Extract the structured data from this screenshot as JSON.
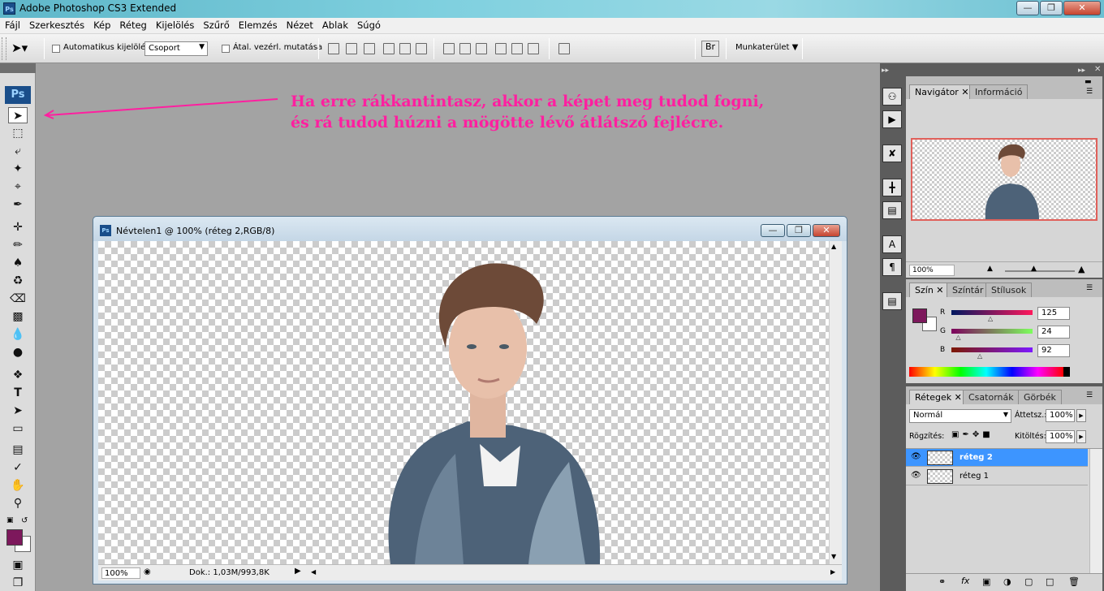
{
  "window": {
    "title": "Adobe Photoshop CS3 Extended",
    "ps_badge": "Ps"
  },
  "menu": [
    "Fájl",
    "Szerkesztés",
    "Kép",
    "Réteg",
    "Kijelölés",
    "Szűrő",
    "Elemzés",
    "Nézet",
    "Ablak",
    "Súgó"
  ],
  "options": {
    "auto_select_label": "Automatikus kijelölés:",
    "auto_select_value": "Csoport",
    "show_transform_label": "Átal. vezérl. mutatása",
    "workspace_label": "Munkaterület"
  },
  "instruction": {
    "line1": "Ha erre rákkantintasz, akkor a képet meg tudod fogni,",
    "line2": "és rá tudod húzni a mögötte lévő átlátszó fejlécre.",
    "color": "#ff1fa0"
  },
  "document": {
    "title": "Névtelen1 @ 100% (réteg 2,RGB/8)",
    "zoom": "100%",
    "doc_size": "Dok.: 1,03M/993,8K"
  },
  "navigator": {
    "tabs": [
      "Navigátor",
      "Információ"
    ],
    "zoom": "100%"
  },
  "color_panel": {
    "tabs": [
      "Szín",
      "Színtár",
      "Stílusok"
    ],
    "foreground": "#7d185c",
    "channels": [
      {
        "label": "R",
        "value": "125",
        "level": 0.49
      },
      {
        "label": "G",
        "value": "24",
        "level": 0.094
      },
      {
        "label": "B",
        "value": "92",
        "level": 0.36
      }
    ]
  },
  "layers_panel": {
    "tabs": [
      "Rétegek",
      "Csatornák",
      "Görbék"
    ],
    "blend_mode": "Normál",
    "opacity_label": "Áttetsz.:",
    "opacity": "100%",
    "lock_label": "Rögzítés:",
    "fill_label": "Kitöltés:",
    "fill": "100%",
    "layers": [
      {
        "name": "réteg 2",
        "selected": true
      },
      {
        "name": "réteg 1",
        "selected": false
      }
    ]
  }
}
